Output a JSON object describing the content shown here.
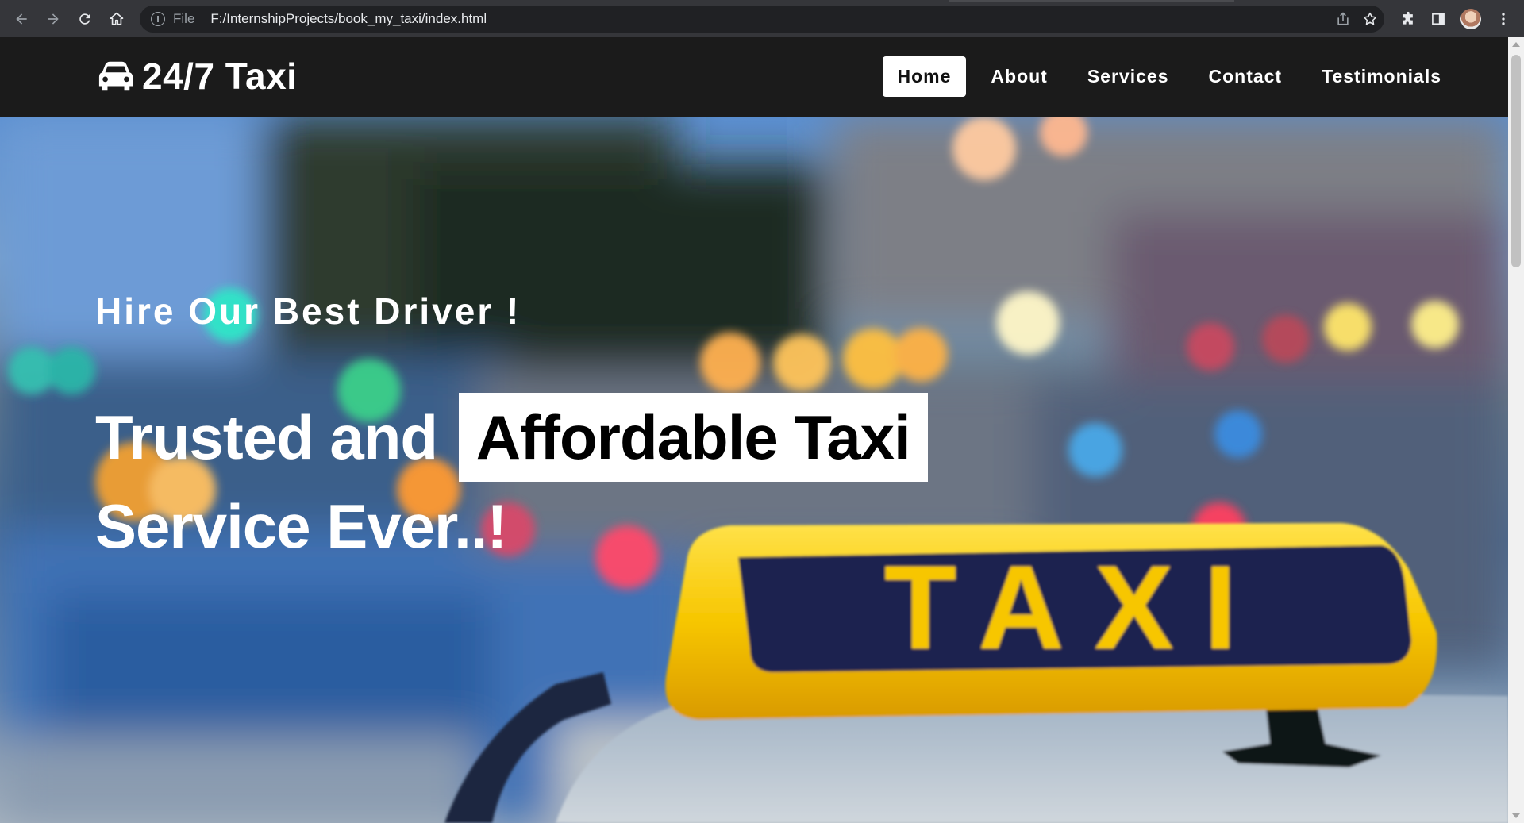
{
  "browser": {
    "scheme_label": "File",
    "url": "F:/InternshipProjects/book_my_taxi/index.html"
  },
  "site": {
    "logo_text": "24/7 Taxi",
    "nav": [
      {
        "label": "Home",
        "active": true
      },
      {
        "label": "About",
        "active": false
      },
      {
        "label": "Services",
        "active": false
      },
      {
        "label": "Contact",
        "active": false
      },
      {
        "label": "Testimonials",
        "active": false
      }
    ]
  },
  "hero": {
    "subtitle": "Hire Our Best Driver !",
    "title_part1": "Trusted and",
    "title_highlight": "Affordable Taxi",
    "title_part2": "Service Ever..!",
    "sign_text": "TAXI"
  },
  "colors": {
    "header_bg": "#1b1b1b",
    "taxi_yellow": "#f7c600",
    "sign_navy": "#1a2450"
  }
}
